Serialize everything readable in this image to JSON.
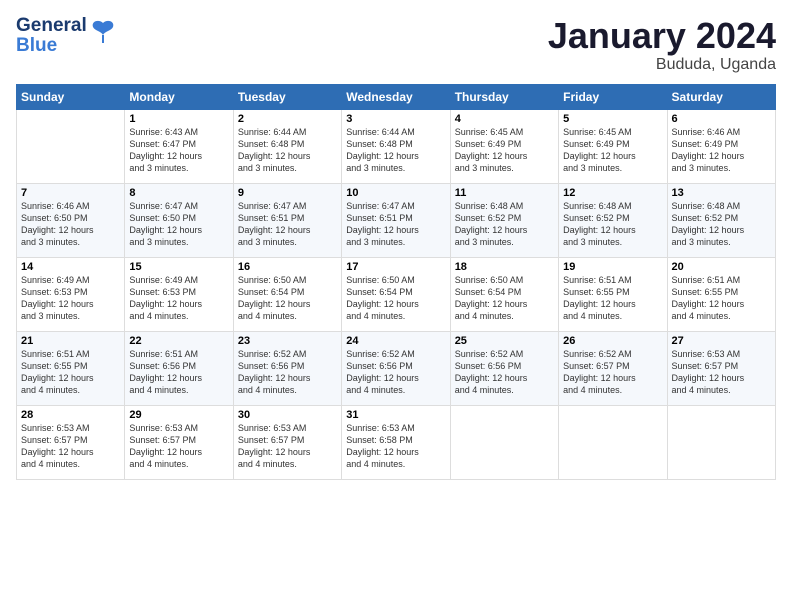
{
  "logo": {
    "line1": "General",
    "line2": "Blue"
  },
  "title": "January 2024",
  "subtitle": "Bududa, Uganda",
  "days_header": [
    "Sunday",
    "Monday",
    "Tuesday",
    "Wednesday",
    "Thursday",
    "Friday",
    "Saturday"
  ],
  "weeks": [
    [
      {
        "num": "",
        "info": ""
      },
      {
        "num": "1",
        "info": "Sunrise: 6:43 AM\nSunset: 6:47 PM\nDaylight: 12 hours\nand 3 minutes."
      },
      {
        "num": "2",
        "info": "Sunrise: 6:44 AM\nSunset: 6:48 PM\nDaylight: 12 hours\nand 3 minutes."
      },
      {
        "num": "3",
        "info": "Sunrise: 6:44 AM\nSunset: 6:48 PM\nDaylight: 12 hours\nand 3 minutes."
      },
      {
        "num": "4",
        "info": "Sunrise: 6:45 AM\nSunset: 6:49 PM\nDaylight: 12 hours\nand 3 minutes."
      },
      {
        "num": "5",
        "info": "Sunrise: 6:45 AM\nSunset: 6:49 PM\nDaylight: 12 hours\nand 3 minutes."
      },
      {
        "num": "6",
        "info": "Sunrise: 6:46 AM\nSunset: 6:49 PM\nDaylight: 12 hours\nand 3 minutes."
      }
    ],
    [
      {
        "num": "7",
        "info": "Sunrise: 6:46 AM\nSunset: 6:50 PM\nDaylight: 12 hours\nand 3 minutes."
      },
      {
        "num": "8",
        "info": "Sunrise: 6:47 AM\nSunset: 6:50 PM\nDaylight: 12 hours\nand 3 minutes."
      },
      {
        "num": "9",
        "info": "Sunrise: 6:47 AM\nSunset: 6:51 PM\nDaylight: 12 hours\nand 3 minutes."
      },
      {
        "num": "10",
        "info": "Sunrise: 6:47 AM\nSunset: 6:51 PM\nDaylight: 12 hours\nand 3 minutes."
      },
      {
        "num": "11",
        "info": "Sunrise: 6:48 AM\nSunset: 6:52 PM\nDaylight: 12 hours\nand 3 minutes."
      },
      {
        "num": "12",
        "info": "Sunrise: 6:48 AM\nSunset: 6:52 PM\nDaylight: 12 hours\nand 3 minutes."
      },
      {
        "num": "13",
        "info": "Sunrise: 6:48 AM\nSunset: 6:52 PM\nDaylight: 12 hours\nand 3 minutes."
      }
    ],
    [
      {
        "num": "14",
        "info": "Sunrise: 6:49 AM\nSunset: 6:53 PM\nDaylight: 12 hours\nand 3 minutes."
      },
      {
        "num": "15",
        "info": "Sunrise: 6:49 AM\nSunset: 6:53 PM\nDaylight: 12 hours\nand 4 minutes."
      },
      {
        "num": "16",
        "info": "Sunrise: 6:50 AM\nSunset: 6:54 PM\nDaylight: 12 hours\nand 4 minutes."
      },
      {
        "num": "17",
        "info": "Sunrise: 6:50 AM\nSunset: 6:54 PM\nDaylight: 12 hours\nand 4 minutes."
      },
      {
        "num": "18",
        "info": "Sunrise: 6:50 AM\nSunset: 6:54 PM\nDaylight: 12 hours\nand 4 minutes."
      },
      {
        "num": "19",
        "info": "Sunrise: 6:51 AM\nSunset: 6:55 PM\nDaylight: 12 hours\nand 4 minutes."
      },
      {
        "num": "20",
        "info": "Sunrise: 6:51 AM\nSunset: 6:55 PM\nDaylight: 12 hours\nand 4 minutes."
      }
    ],
    [
      {
        "num": "21",
        "info": "Sunrise: 6:51 AM\nSunset: 6:55 PM\nDaylight: 12 hours\nand 4 minutes."
      },
      {
        "num": "22",
        "info": "Sunrise: 6:51 AM\nSunset: 6:56 PM\nDaylight: 12 hours\nand 4 minutes."
      },
      {
        "num": "23",
        "info": "Sunrise: 6:52 AM\nSunset: 6:56 PM\nDaylight: 12 hours\nand 4 minutes."
      },
      {
        "num": "24",
        "info": "Sunrise: 6:52 AM\nSunset: 6:56 PM\nDaylight: 12 hours\nand 4 minutes."
      },
      {
        "num": "25",
        "info": "Sunrise: 6:52 AM\nSunset: 6:56 PM\nDaylight: 12 hours\nand 4 minutes."
      },
      {
        "num": "26",
        "info": "Sunrise: 6:52 AM\nSunset: 6:57 PM\nDaylight: 12 hours\nand 4 minutes."
      },
      {
        "num": "27",
        "info": "Sunrise: 6:53 AM\nSunset: 6:57 PM\nDaylight: 12 hours\nand 4 minutes."
      }
    ],
    [
      {
        "num": "28",
        "info": "Sunrise: 6:53 AM\nSunset: 6:57 PM\nDaylight: 12 hours\nand 4 minutes."
      },
      {
        "num": "29",
        "info": "Sunrise: 6:53 AM\nSunset: 6:57 PM\nDaylight: 12 hours\nand 4 minutes."
      },
      {
        "num": "30",
        "info": "Sunrise: 6:53 AM\nSunset: 6:57 PM\nDaylight: 12 hours\nand 4 minutes."
      },
      {
        "num": "31",
        "info": "Sunrise: 6:53 AM\nSunset: 6:58 PM\nDaylight: 12 hours\nand 4 minutes."
      },
      {
        "num": "",
        "info": ""
      },
      {
        "num": "",
        "info": ""
      },
      {
        "num": "",
        "info": ""
      }
    ]
  ]
}
